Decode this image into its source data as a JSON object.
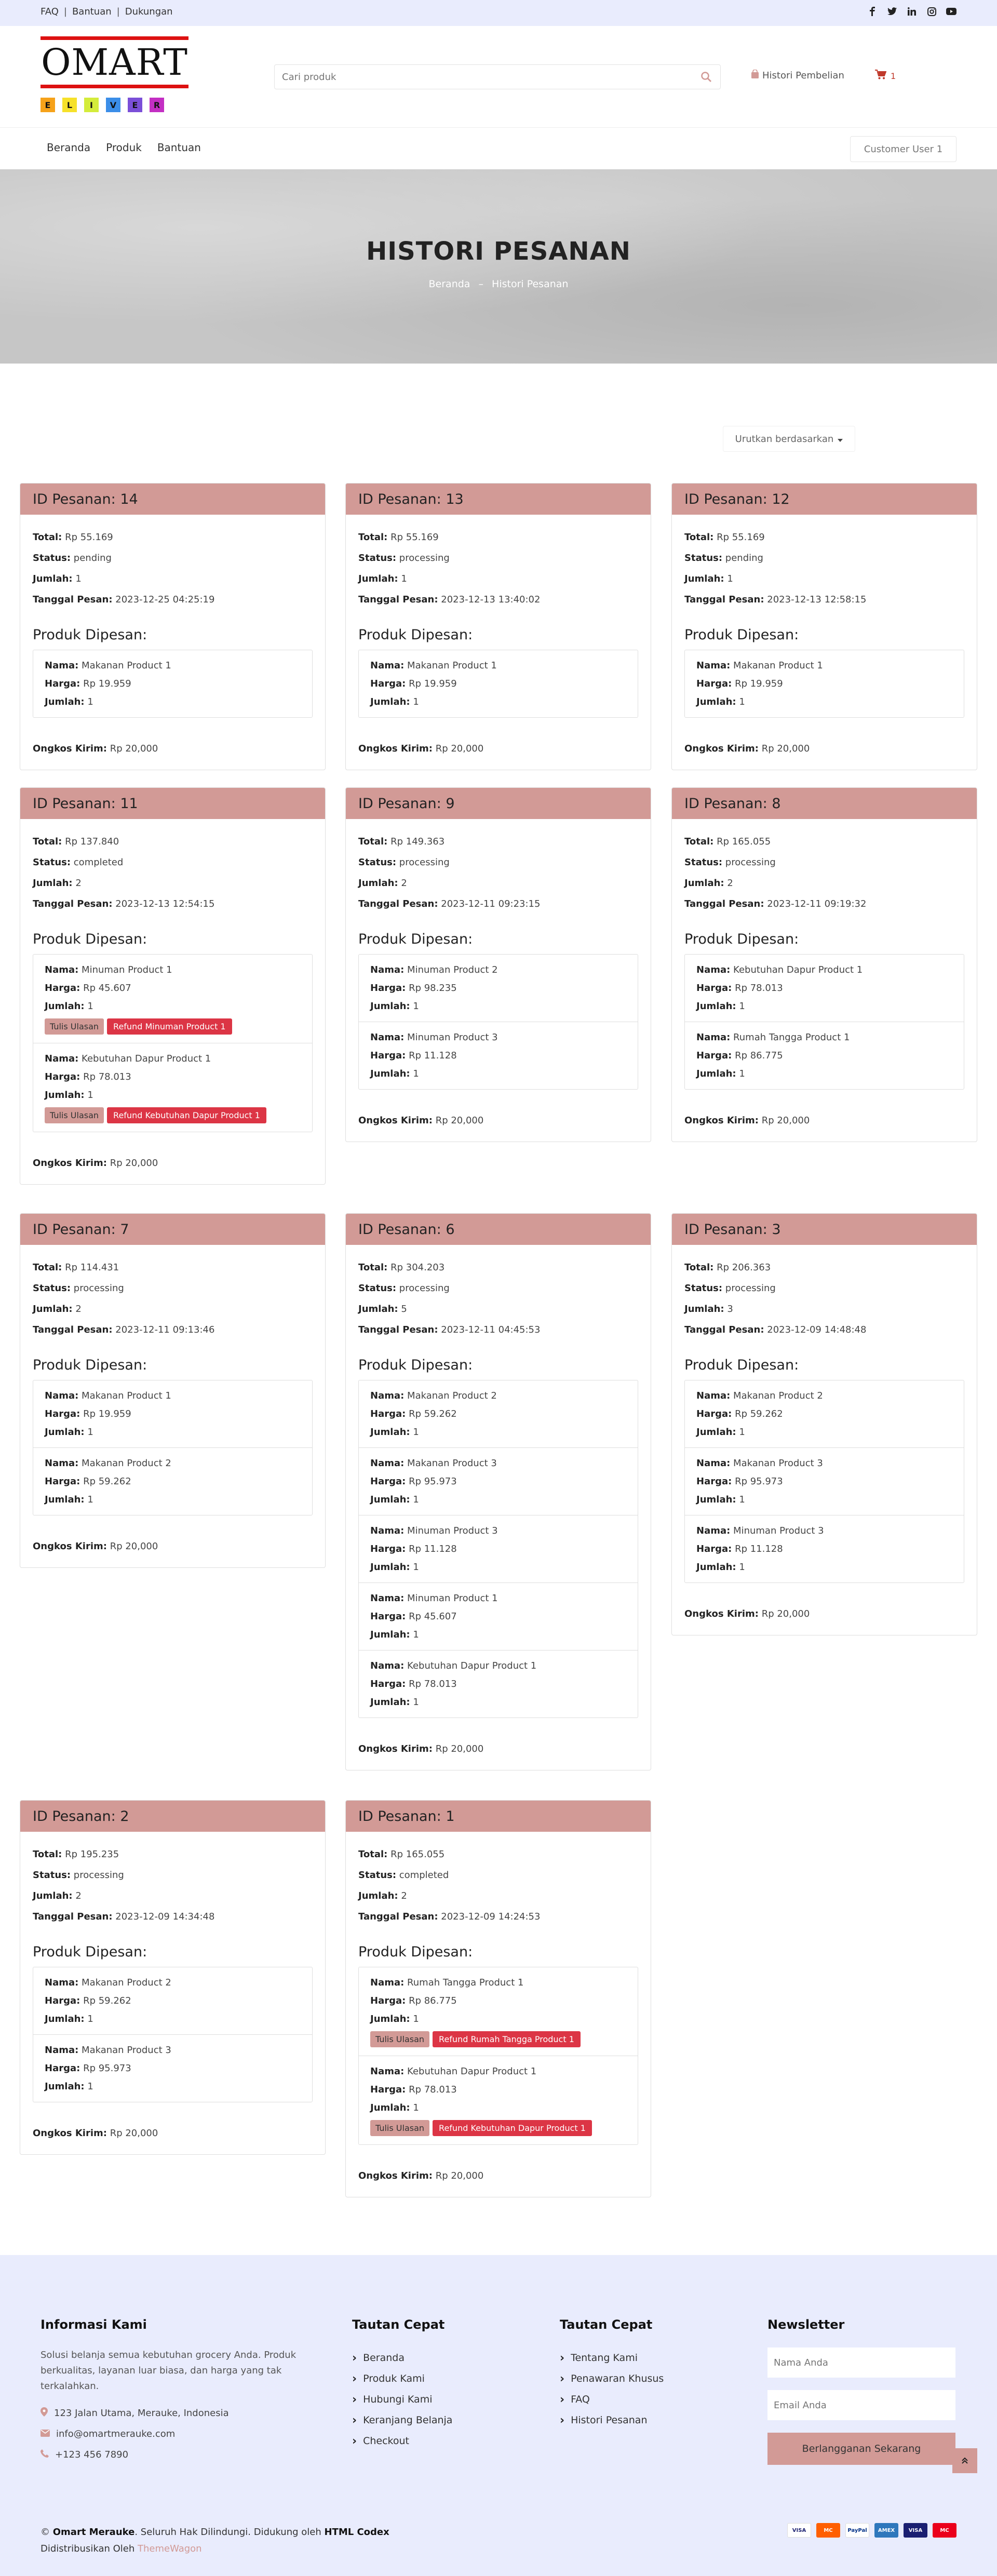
{
  "topbar": {
    "links": [
      "FAQ",
      "Bantuan",
      "Dukungan"
    ],
    "social_icons": [
      "facebook-icon",
      "twitter-icon",
      "linkedin-icon",
      "instagram-icon",
      "youtube-icon"
    ]
  },
  "header": {
    "logo_text": "OMART",
    "logo_tiles": [
      "E",
      "L",
      "I",
      "V",
      "E",
      "R"
    ],
    "search_placeholder": "Cari produk",
    "history_link": "Histori Pembelian",
    "cart_count": "1"
  },
  "nav": {
    "links": [
      "Beranda",
      "Produk",
      "Bantuan"
    ],
    "user": "Customer User 1"
  },
  "hero": {
    "title": "HISTORI PESANAN",
    "crumb_home": "Beranda",
    "crumb_sep": "–",
    "crumb_current": "Histori Pesanan"
  },
  "sort_label": "Urutkan berdasarkan",
  "labels": {
    "total": "Total:",
    "status": "Status:",
    "qty": "Jumlah:",
    "date": "Tanggal Pesan:",
    "products": "Produk Dipesan:",
    "name": "Nama:",
    "price": "Harga:",
    "shipping": "Ongkos Kirim:",
    "review": "Tulis Ulasan",
    "refund_prefix": "Refund "
  },
  "orders": [
    {
      "id": "ID Pesanan: 14",
      "total": "Rp 55.169",
      "status": "pending",
      "qty": "1",
      "date": "2023-12-25 04:25:19",
      "shipping": "Rp 20,000",
      "items": [
        {
          "name": "Makanan Product 1",
          "price": "Rp 19.959",
          "qty": "1"
        }
      ]
    },
    {
      "id": "ID Pesanan: 13",
      "total": "Rp 55.169",
      "status": "processing",
      "qty": "1",
      "date": "2023-12-13 13:40:02",
      "shipping": "Rp 20,000",
      "items": [
        {
          "name": "Makanan Product 1",
          "price": "Rp 19.959",
          "qty": "1"
        }
      ]
    },
    {
      "id": "ID Pesanan: 12",
      "total": "Rp 55.169",
      "status": "pending",
      "qty": "1",
      "date": "2023-12-13 12:58:15",
      "shipping": "Rp 20,000",
      "items": [
        {
          "name": "Makanan Product 1",
          "price": "Rp 19.959",
          "qty": "1"
        }
      ]
    },
    {
      "id": "ID Pesanan: 11",
      "total": "Rp 137.840",
      "status": "completed",
      "qty": "2",
      "date": "2023-12-13 12:54:15",
      "shipping": "Rp 20,000",
      "items": [
        {
          "name": "Minuman Product 1",
          "price": "Rp 45.607",
          "qty": "1",
          "actions": true,
          "refund": "Refund Minuman Product 1"
        },
        {
          "name": "Kebutuhan Dapur Product 1",
          "price": "Rp 78.013",
          "qty": "1",
          "actions": true,
          "refund": "Refund Kebutuhan Dapur Product 1"
        }
      ]
    },
    {
      "id": "ID Pesanan: 9",
      "total": "Rp 149.363",
      "status": "processing",
      "qty": "2",
      "date": "2023-12-11 09:23:15",
      "shipping": "Rp 20,000",
      "items": [
        {
          "name": "Minuman Product 2",
          "price": "Rp 98.235",
          "qty": "1"
        },
        {
          "name": "Minuman Product 3",
          "price": "Rp 11.128",
          "qty": "1"
        }
      ]
    },
    {
      "id": "ID Pesanan: 8",
      "total": "Rp 165.055",
      "status": "processing",
      "qty": "2",
      "date": "2023-12-11 09:19:32",
      "shipping": "Rp 20,000",
      "items": [
        {
          "name": "Kebutuhan Dapur Product 1",
          "price": "Rp 78.013",
          "qty": "1"
        },
        {
          "name": "Rumah Tangga Product 1",
          "price": "Rp 86.775",
          "qty": "1"
        }
      ]
    },
    {
      "id": "ID Pesanan: 7",
      "total": "Rp 114.431",
      "status": "processing",
      "qty": "2",
      "date": "2023-12-11 09:13:46",
      "shipping": "Rp 20,000",
      "items": [
        {
          "name": "Makanan Product 1",
          "price": "Rp 19.959",
          "qty": "1"
        },
        {
          "name": "Makanan Product 2",
          "price": "Rp 59.262",
          "qty": "1"
        }
      ]
    },
    {
      "id": "ID Pesanan: 6",
      "total": "Rp 304.203",
      "status": "processing",
      "qty": "5",
      "date": "2023-12-11 04:45:53",
      "shipping": "Rp 20,000",
      "items": [
        {
          "name": "Makanan Product 2",
          "price": "Rp 59.262",
          "qty": "1"
        },
        {
          "name": "Makanan Product 3",
          "price": "Rp 95.973",
          "qty": "1"
        },
        {
          "name": "Minuman Product 3",
          "price": "Rp 11.128",
          "qty": "1"
        },
        {
          "name": "Minuman Product 1",
          "price": "Rp 45.607",
          "qty": "1"
        },
        {
          "name": "Kebutuhan Dapur Product 1",
          "price": "Rp 78.013",
          "qty": "1"
        }
      ]
    },
    {
      "id": "ID Pesanan: 3",
      "total": "Rp 206.363",
      "status": "processing",
      "qty": "3",
      "date": "2023-12-09 14:48:48",
      "shipping": "Rp 20,000",
      "items": [
        {
          "name": "Makanan Product 2",
          "price": "Rp 59.262",
          "qty": "1"
        },
        {
          "name": "Makanan Product 3",
          "price": "Rp 95.973",
          "qty": "1"
        },
        {
          "name": "Minuman Product 3",
          "price": "Rp 11.128",
          "qty": "1"
        }
      ]
    },
    {
      "id": "ID Pesanan: 2",
      "total": "Rp 195.235",
      "status": "processing",
      "qty": "2",
      "date": "2023-12-09 14:34:48",
      "shipping": "Rp 20,000",
      "items": [
        {
          "name": "Makanan Product 2",
          "price": "Rp 59.262",
          "qty": "1"
        },
        {
          "name": "Makanan Product 3",
          "price": "Rp 95.973",
          "qty": "1"
        }
      ]
    },
    {
      "id": "ID Pesanan: 1",
      "total": "Rp 165.055",
      "status": "completed",
      "qty": "2",
      "date": "2023-12-09 14:24:53",
      "shipping": "Rp 20,000",
      "items": [
        {
          "name": "Rumah Tangga Product 1",
          "price": "Rp 86.775",
          "qty": "1",
          "actions": true,
          "refund": "Refund Rumah Tangga Product 1"
        },
        {
          "name": "Kebutuhan Dapur Product 1",
          "price": "Rp 78.013",
          "qty": "1",
          "actions": true,
          "refund": "Refund Kebutuhan Dapur Product 1"
        }
      ]
    }
  ],
  "footer": {
    "about_title": "Informasi Kami",
    "about_text": "Solusi belanja semua kebutuhan grocery Anda. Produk berkualitas, layanan luar biasa, dan harga yang tak terkalahkan.",
    "address": "123 Jalan Utama, Merauke, Indonesia",
    "email": "info@omartmerauke.com",
    "phone": "+123 456 7890",
    "links1_title": "Tautan Cepat",
    "links1": [
      "Beranda",
      "Produk Kami",
      "Hubungi Kami",
      "Keranjang Belanja",
      "Checkout"
    ],
    "links2_title": "Tautan Cepat",
    "links2": [
      "Tentang Kami",
      "Penawaran Khusus",
      "FAQ",
      "Histori Pesanan"
    ],
    "newsletter_title": "Newsletter",
    "name_placeholder": "Nama Anda",
    "email_placeholder": "Email Anda",
    "subscribe": "Berlangganan Sekarang",
    "copyright_symbol": "©",
    "brand": "Omart Merauke",
    "rights": ". Seluruh Hak Dilindungi. Didukung oleh ",
    "powered": "HTML Codex",
    "distributed": "Didistribusikan Oleh ",
    "themewagon": "ThemeWagon",
    "payments": [
      "VISA",
      "MC",
      "PayPal",
      "AMEX",
      "VISA",
      "MC"
    ]
  },
  "colors": {
    "accent": "#d29a96",
    "danger": "#dc3545",
    "topbar": "#e9ecfd"
  }
}
